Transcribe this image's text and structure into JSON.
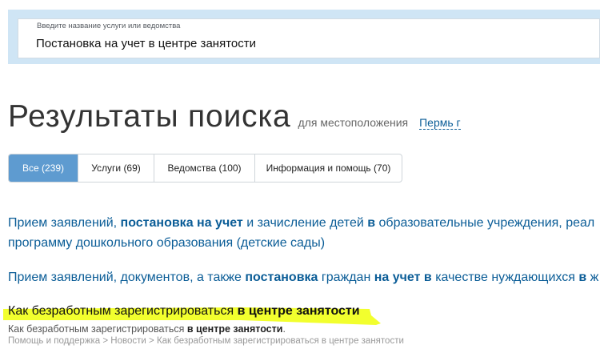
{
  "search": {
    "hint": "Введите название услуги или ведомства",
    "value": "Постановка на учет в центре занятости"
  },
  "header": {
    "title": "Результаты поиска",
    "location_prefix": "для местоположения",
    "location_value": "Пермь г"
  },
  "tabs": [
    {
      "label": "Все (239)",
      "active": true
    },
    {
      "label": "Услуги (69)",
      "active": false
    },
    {
      "label": "Ведомства (100)",
      "active": false
    },
    {
      "label": "Информация и помощь (70)",
      "active": false
    }
  ],
  "results": [
    {
      "line1": [
        "Прием заявлений, ",
        "постановка на учет",
        " и зачисление детей ",
        "в",
        " образовательные учреждения, реал"
      ],
      "line2": "программу дошкольного образования (детские сады)"
    },
    {
      "line1": [
        "Прием заявлений, документов, а также ",
        "постановка",
        " граждан ",
        "на учет",
        " ",
        "в",
        " качестве нуждающихся ",
        "в",
        " ж"
      ]
    },
    {
      "title": [
        "Как безработным зарегистрироваться ",
        "в центре занятости"
      ],
      "snippet": [
        "Как безработным зарегистрироваться ",
        "в центре занятости",
        "."
      ],
      "breadcrumb": [
        "Помощь и поддержка",
        "Новости",
        "Как безработным зарегистрироваться в центре занятости"
      ],
      "breadcrumb_separator": " > "
    }
  ],
  "colors": {
    "link": "#0b5d97",
    "active_tab": "#5e9bd0",
    "search_frame": "#cfe5f5",
    "highlight": "#f2ff2e"
  }
}
